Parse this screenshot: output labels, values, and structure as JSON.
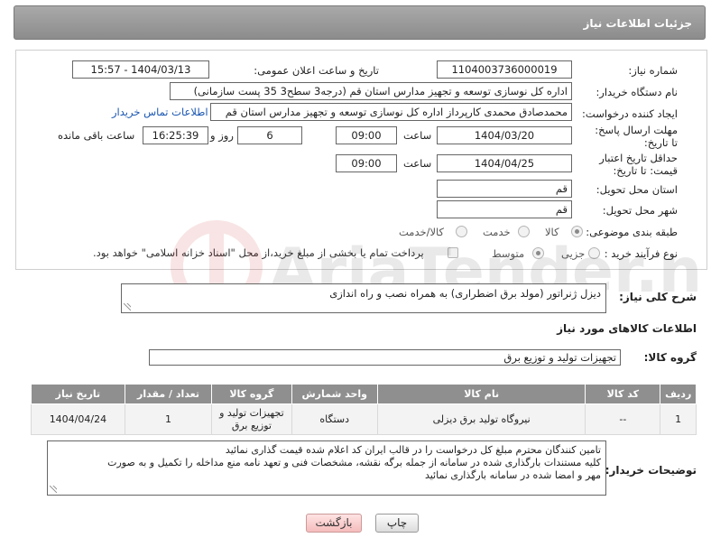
{
  "header": {
    "title": "جزئیات اطلاعات نیاز"
  },
  "form": {
    "need_number_label": "شماره نیاز:",
    "need_number": "1104003736000019",
    "announce_label": "تاریخ و ساعت اعلان عمومی:",
    "announce_value": "1404/03/13 - 15:57",
    "buyer_org_label": "نام دستگاه خریدار:",
    "buyer_org": "اداره کل نوسازی   توسعه و تجهیز مدارس استان قم (درجه3 سطح3  35 پست سازمانی)",
    "creator_label": "ایجاد کننده درخواست:",
    "creator": "محمدصادق محمدی کارپرداز  اداره کل نوسازی   توسعه و تجهیز مدارس استان قم",
    "contact_link": "اطلاعات تماس خریدار",
    "deadline_label": "مهلت ارسال پاسخ: تا تاریخ:",
    "deadline_date": "1404/03/20",
    "time_label": "ساعت",
    "deadline_time": "09:00",
    "days_value": "6",
    "days_label": "روز و",
    "remaining_time": "16:25:39",
    "remaining_label": "ساعت باقی مانده",
    "validity_label": "حداقل تاریخ اعتبار قیمت: تا تاریخ:",
    "validity_date": "1404/04/25",
    "validity_time": "09:00",
    "province_label": "استان محل تحویل:",
    "province": "قم",
    "city_label": "شهر محل تحویل:",
    "city": "قم",
    "category_label": "طبقه بندی موضوعی:",
    "category_options": [
      "کالا",
      "خدمت",
      "کالا/خدمت"
    ],
    "purchase_type_label": "نوع فرآیند خرید :",
    "purchase_options": [
      "جزیی",
      "متوسط"
    ],
    "payment_note": "پرداخت تمام یا بخشی از مبلغ خرید،از محل \"اسناد خزانه اسلامی\" خواهد بود."
  },
  "description": {
    "label": "شرح کلی نیاز:",
    "text": "دیزل ژنراتور (مولد برق اضطراری) به همراه نصب و راه اندازی"
  },
  "goods": {
    "section_title": "اطلاعات کالاهای مورد نیاز",
    "group_label": "گروه کالا:",
    "group_value": "تجهیزات تولید و توزیع برق",
    "columns": [
      "ردیف",
      "کد کالا",
      "نام کالا",
      "واحد شمارش",
      "گروه کالا",
      "تعداد / مقدار",
      "تاریخ نیاز"
    ],
    "rows": [
      [
        "1",
        "--",
        "نیروگاه تولید برق دیزلی",
        "دستگاه",
        "تجهیزات تولید و توزیع برق",
        "1",
        "1404/04/24"
      ]
    ]
  },
  "buyer_notes": {
    "label": "توضیحات خریدار:",
    "line1": "تامین کنندگان محترم مبلغ کل درخواست را در قالب ایران کد اعلام شده قیمت گذاری نمائید",
    "line2": "کلیه مستندات بارگذاری شده در سامانه از جمله برگه نقشه، مشخصات فنی و تعهد نامه منع مداخله را تکمیل و به صورت",
    "line3": "مهر و امضا شده در سامانه بارگذاری نمائید"
  },
  "buttons": {
    "print": "چاپ",
    "back": "بازگشت"
  },
  "watermark": {
    "text": "AriaTender.net"
  },
  "colors": {
    "header": "#8c8c8c",
    "link": "#1a56b0",
    "table_header": "#8f8f8f",
    "back_button": "#f5bcbc"
  }
}
